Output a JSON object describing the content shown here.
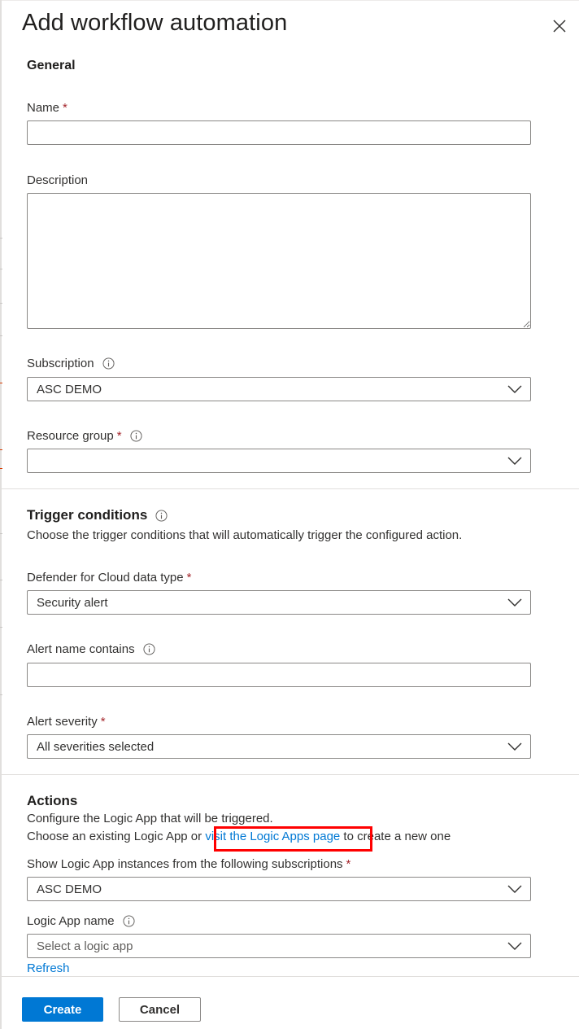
{
  "panel": {
    "title": "Add workflow automation",
    "close_icon": "close-icon"
  },
  "general": {
    "heading": "General",
    "name_label": "Name",
    "name_value": "",
    "description_label": "Description",
    "description_value": "",
    "subscription_label": "Subscription",
    "subscription_value": "ASC DEMO",
    "resource_group_label": "Resource group",
    "resource_group_value": ""
  },
  "trigger": {
    "heading": "Trigger conditions",
    "description": "Choose the trigger conditions that will automatically trigger the configured action.",
    "data_type_label": "Defender for Cloud data type",
    "data_type_value": "Security alert",
    "alert_name_label": "Alert name contains",
    "alert_name_value": "",
    "severity_label": "Alert severity",
    "severity_value": "All severities selected"
  },
  "actions": {
    "heading": "Actions",
    "line1": "Configure the Logic App that will be triggered.",
    "line2_prefix": "Choose an existing Logic App or ",
    "line2_link": "visit the Logic Apps page",
    "line2_suffix": " to create a new one",
    "subscriptions_label": "Show Logic App instances from the following subscriptions",
    "subscriptions_value": "ASC DEMO",
    "logic_app_label": "Logic App name",
    "logic_app_placeholder": "Select a logic app",
    "refresh_label": "Refresh"
  },
  "footer": {
    "create_label": "Create",
    "cancel_label": "Cancel"
  },
  "required_marker": "*",
  "colors": {
    "accent": "#0078d4",
    "required": "#a4262c",
    "highlight": "#ff0000"
  }
}
